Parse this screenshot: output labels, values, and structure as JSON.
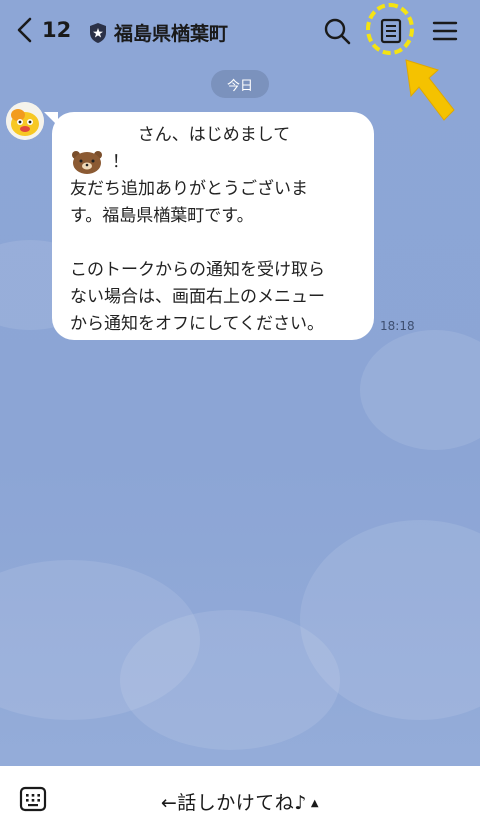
{
  "header": {
    "back_count": "12",
    "title": "福島県楢葉町",
    "icons": [
      "chevron-left-icon",
      "shield-star-icon",
      "search-icon",
      "note-icon",
      "menu-icon"
    ]
  },
  "chat": {
    "date_label": "今日",
    "message": {
      "greeting": "さん、はじめまして",
      "exclaim": "！",
      "lines": [
        "友だち追加ありがとうございま",
        "す。福島県楢葉町です。",
        "",
        "このトークからの通知を受け取ら",
        "ない場合は、画面右上のメニュー",
        "から通知をオフにしてください。"
      ],
      "time": "18:18"
    }
  },
  "footer": {
    "prompt": "←話しかけてね♪",
    "caret": "▲"
  },
  "colors": {
    "chat_background": "#8CA5D5",
    "highlight": "#F4E313",
    "arrow": "#F5C200"
  }
}
